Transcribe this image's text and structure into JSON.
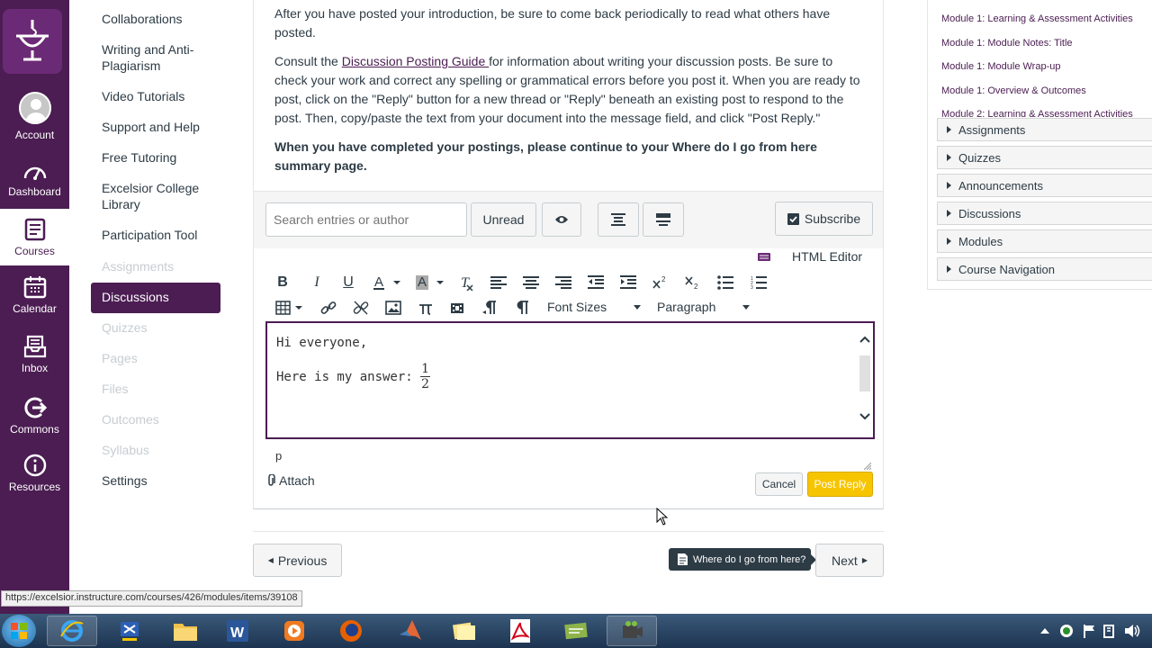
{
  "global_nav": {
    "items": [
      {
        "label": "Account",
        "icon": "account-icon"
      },
      {
        "label": "Dashboard",
        "icon": "dashboard-icon"
      },
      {
        "label": "Courses",
        "icon": "courses-icon"
      },
      {
        "label": "Calendar",
        "icon": "calendar-icon"
      },
      {
        "label": "Inbox",
        "icon": "inbox-icon"
      },
      {
        "label": "Commons",
        "icon": "commons-icon"
      },
      {
        "label": "Resources",
        "icon": "resources-icon"
      }
    ],
    "active": "Courses"
  },
  "course_nav": {
    "items": [
      {
        "label": "Collaborations",
        "enabled": true
      },
      {
        "label": "Writing and Anti-Plagiarism",
        "enabled": true
      },
      {
        "label": "Video Tutorials",
        "enabled": true
      },
      {
        "label": "Support and Help",
        "enabled": true
      },
      {
        "label": "Free Tutoring",
        "enabled": true
      },
      {
        "label": "Excelsior College Library",
        "enabled": true
      },
      {
        "label": "Participation Tool",
        "enabled": true
      },
      {
        "label": "Assignments",
        "enabled": false
      },
      {
        "label": "Discussions",
        "enabled": true,
        "active": true
      },
      {
        "label": "Quizzes",
        "enabled": false
      },
      {
        "label": "Pages",
        "enabled": false
      },
      {
        "label": "Files",
        "enabled": false
      },
      {
        "label": "Outcomes",
        "enabled": false
      },
      {
        "label": "Syllabus",
        "enabled": false
      },
      {
        "label": "Settings",
        "enabled": true
      }
    ]
  },
  "content": {
    "para1": "After you have posted your introduction, be sure to come back periodically to read what others have posted.",
    "para2_before": "Consult the ",
    "para2_link": "Discussion Posting Guide ",
    "para2_after": "for information about writing your discussion posts. Be sure to check your work and correct any spelling or grammatical errors before you post it. When you are ready to post, click on the \"Reply\" button for a new thread or \"Reply\" beneath an existing post to respond to the post. Then, copy/paste the text from your document into the message field, and click \"Post Reply.\"",
    "para3": "When you have completed your postings, please continue to your Where do I go from here summary page."
  },
  "toolbar": {
    "search_placeholder": "Search entries or author",
    "unread_label": "Unread",
    "subscribe_label": "Subscribe"
  },
  "editor": {
    "html_editor_label": "HTML Editor",
    "font_sizes_label": "Font Sizes",
    "paragraph_label": "Paragraph",
    "line1": "Hi everyone,",
    "line2": "Here is my answer: ",
    "fraction_num": "1",
    "fraction_den": "2",
    "status_path": "p",
    "attach_label": "Attach",
    "cancel_label": "Cancel",
    "post_label": "Post Reply"
  },
  "footer": {
    "previous_label": "Previous",
    "next_label": "Next",
    "tooltip": "Where do I go from here?"
  },
  "right_panel": {
    "modules": [
      "Module 1: Learning & Assessment Activities",
      "Module 1: Module Notes: Title",
      "Module 1: Module Wrap-up",
      "Module 1: Overview & Outcomes",
      "Module 2: Learning & Assessment Activities"
    ],
    "sections": [
      "Assignments",
      "Quizzes",
      "Announcements",
      "Discussions",
      "Modules",
      "Course Navigation"
    ]
  },
  "status_url": "https://excelsior.instructure.com/courses/426/modules/items/39108",
  "colors": {
    "brand": "#4b1d52",
    "post_button": "#f7c400"
  }
}
